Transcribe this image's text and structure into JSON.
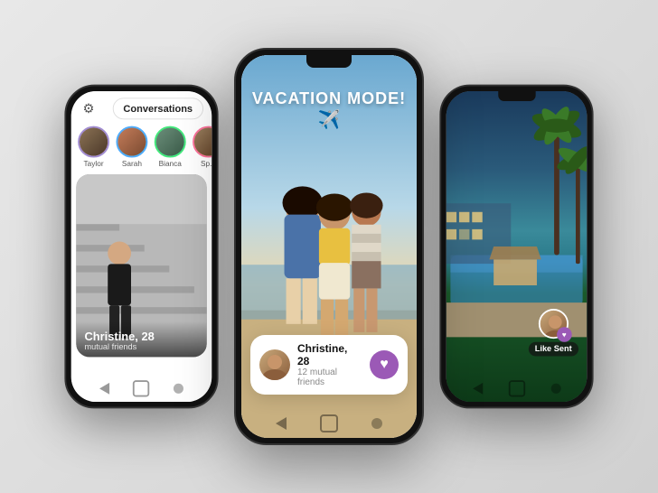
{
  "scene": {
    "background_color": "#e0e0e0"
  },
  "left_phone": {
    "tab_label": "Conversations",
    "stories": [
      {
        "name": "Taylor",
        "color_class": "taylor"
      },
      {
        "name": "Sarah",
        "color_class": "sarah"
      },
      {
        "name": "Bianca",
        "color_class": "bianca"
      },
      {
        "name": "Sp...",
        "color_class": "sp"
      }
    ],
    "card": {
      "name": "Christine, 28",
      "sub": "mutual friends",
      "image_alt": "Woman on stairs"
    },
    "gear_icon": "⚙"
  },
  "center_phone": {
    "vacation_text": "VACATION MODE!",
    "plane_emoji": "✈️",
    "card": {
      "name": "Christine, 28",
      "sub": "12 mutual friends"
    },
    "heart_icon": "♥"
  },
  "right_phone": {
    "like_sent_label": "Like Sent",
    "heart_icon": "♥"
  },
  "nav": {
    "back_label": "◁",
    "home_label": "□",
    "dot_label": "⬤"
  }
}
